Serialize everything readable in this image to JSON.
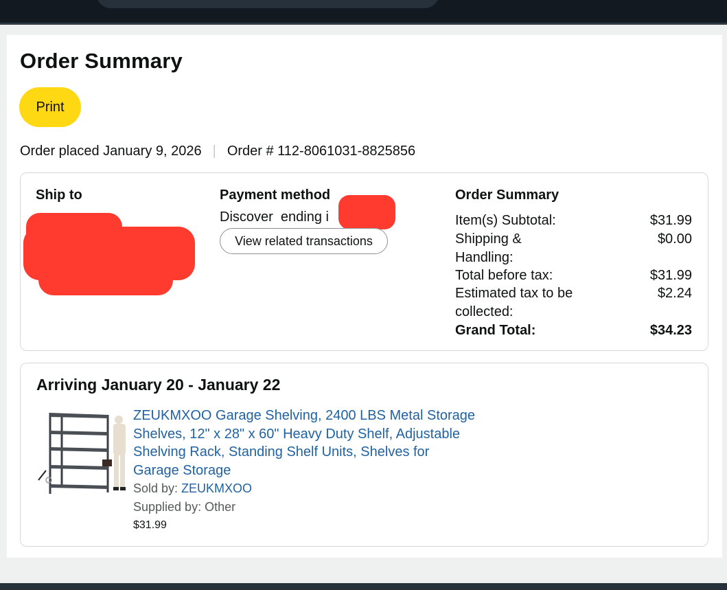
{
  "page": {
    "title": "Order Summary",
    "print_label": "Print",
    "order_placed": "Order placed January 9, 2026",
    "separator": "|",
    "order_number": "Order # 112-8061031-8825856"
  },
  "ship_to": {
    "heading": "Ship to"
  },
  "payment": {
    "heading": "Payment method",
    "card_text": "Discover  ending i",
    "view_transactions_label": "View related transactions"
  },
  "summary": {
    "heading": "Order Summary",
    "rows": [
      {
        "label": "Item(s) Subtotal:",
        "value": "$31.99"
      },
      {
        "label": "Shipping & Handling:",
        "value": "$0.00"
      },
      {
        "label": "Total before tax:",
        "value": "$31.99"
      },
      {
        "label": "Estimated tax to be collected:",
        "value": "$2.24"
      },
      {
        "label": "Grand Total:",
        "value": "$34.23"
      }
    ]
  },
  "shipment": {
    "arrival": "Arriving January 20 - January 22",
    "product_title": "ZEUKMXOO Garage Shelving, 2400 LBS Metal Storage Shelves, 12\" x 28\" x 60\" Heavy Duty Shelf, Adjustable Shelving Rack, Standing Shelf Units, Shelves for Garage Storage",
    "sold_by_label": "Sold by: ",
    "sold_by_value": "ZEUKMXOO",
    "supplied_by": "Supplied by: Other",
    "price": "$31.99"
  },
  "colors": {
    "print_button": "#ffd814",
    "link": "#2162a1",
    "redaction": "#ff3b30",
    "header": "#131921"
  }
}
